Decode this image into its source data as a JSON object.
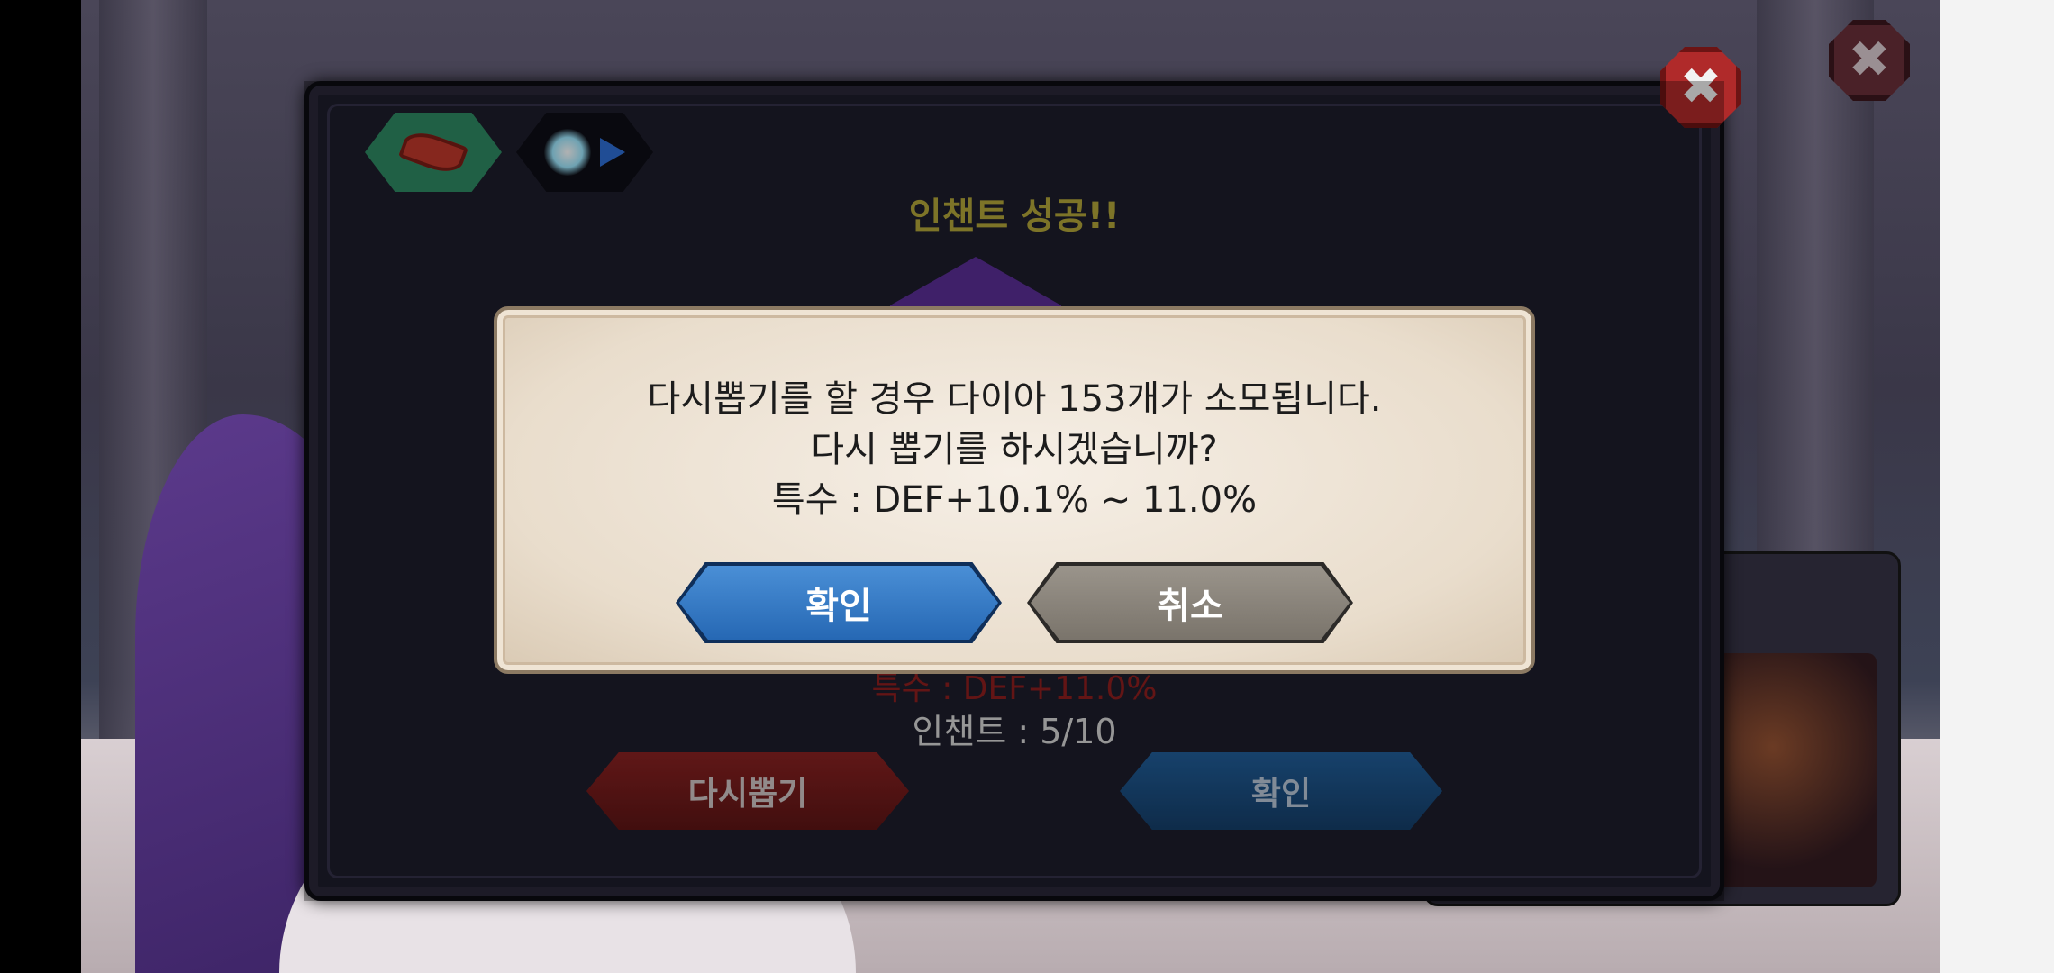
{
  "panel": {
    "title": "인챈트 성공!!",
    "sub_stat": "특수 : DEF+11.0%",
    "enchant_count": "인챈트 : 5/10",
    "reroll_label": "다시뽑기",
    "confirm_label": "확인"
  },
  "dialog": {
    "line1": "다시뽑기를 할 경우 다이아 153개가 소모됩니다.",
    "line2": "다시 뽑기를 하시겠습니까?",
    "line3": "특수 : DEF+10.1% ~ 11.0%",
    "confirm_label": "확인",
    "cancel_label": "취소"
  },
  "icons": {
    "close": "close-icon",
    "item": "red-feather-icon",
    "enchant": "enchant-burst-icon"
  },
  "colors": {
    "title": "#b4a63a",
    "confirm": "#2668b4",
    "cancel": "#7a746b",
    "reroll": "#8a2222",
    "close": "#b02a2a"
  }
}
